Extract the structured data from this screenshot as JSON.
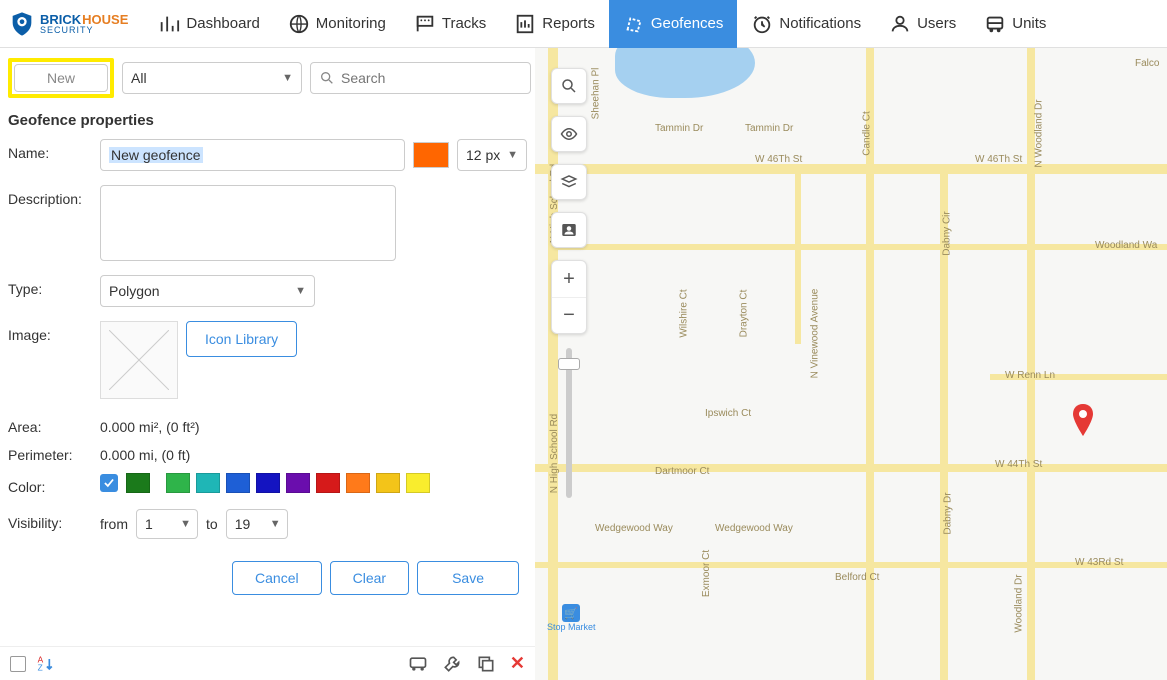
{
  "brand": {
    "line1a": "BRICK",
    "line1b": "HOUSE",
    "line2": "SECURITY"
  },
  "nav": {
    "dashboard": "Dashboard",
    "monitoring": "Monitoring",
    "tracks": "Tracks",
    "reports": "Reports",
    "geofences": "Geofences",
    "notifications": "Notifications",
    "users": "Users",
    "units": "Units"
  },
  "sidebar": {
    "new_btn": "New",
    "filter": "All",
    "search_placeholder": "Search"
  },
  "props": {
    "title": "Geofence properties",
    "name_label": "Name:",
    "name_value": "New geofence",
    "font_size": "12 px",
    "desc_label": "Description:",
    "desc_value": "",
    "type_label": "Type:",
    "type_value": "Polygon",
    "image_label": "Image:",
    "icon_library": "Icon Library",
    "area_label": "Area:",
    "area_value": "0.000 mi², (0 ft²)",
    "perimeter_label": "Perimeter:",
    "perimeter_value": "0.000 mi, (0 ft)",
    "color_label": "Color:",
    "colors": [
      "#1b7a1b",
      "#2fb44a",
      "#1fb6b6",
      "#1e5fd6",
      "#1414c1",
      "#6a0dad",
      "#d61a1a",
      "#ff7a1a",
      "#f3c419",
      "#f9ed2d"
    ],
    "visibility_label": "Visibility:",
    "vis_from": "from",
    "vis_from_val": "1",
    "vis_to": "to",
    "vis_to_val": "19"
  },
  "actions": {
    "cancel": "Cancel",
    "clear": "Clear",
    "save": "Save"
  },
  "map": {
    "streets": {
      "tammin": "Tammin Dr",
      "w46th": "W 46Th St",
      "w44th": "W 44Th St",
      "w43rd": "W 43Rd St",
      "wrenn": "W Renn Ln",
      "woodland": "Woodland Wa",
      "ipswich": "Ipswich Ct",
      "dartmoor": "Dartmoor Ct",
      "wedgewood": "Wedgewood Way",
      "belford": "Belford Ct",
      "exmoor": "Exmoor Ct",
      "wilshire": "Wilshire Ct",
      "drayton": "Drayton Ct",
      "nhigh": "N High School Rd",
      "vinewood": "N Vinewood Avenue",
      "candle": "Candle Ct",
      "dabny": "Dabny Cir",
      "dabnydr": "Dabny Dr",
      "sheehan": "Sheehan Pl",
      "falco": "Falco",
      "woodland2": "N Woodland Dr",
      "woodland3": "Woodland Dr"
    },
    "poi_stop": "Stop Market"
  }
}
